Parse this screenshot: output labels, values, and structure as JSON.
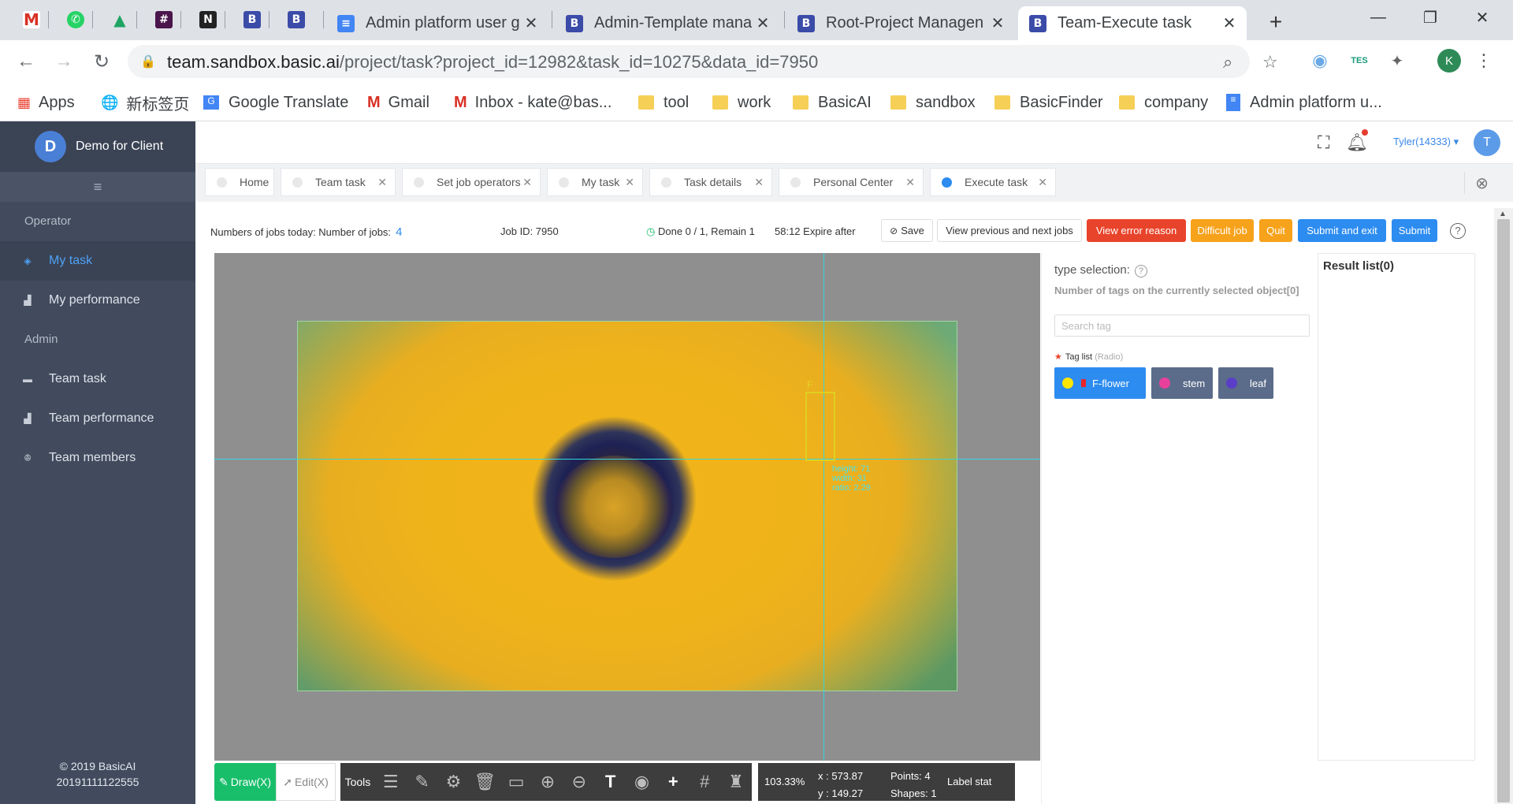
{
  "browser": {
    "pinned_tabs": [
      {
        "icon": "gmail-icon",
        "glyph": "M",
        "color": "#d93025"
      },
      {
        "icon": "whatsapp-icon",
        "glyph": "✆",
        "color": "#25d366"
      },
      {
        "icon": "google-drive-icon",
        "glyph": "▲",
        "color": "#1fa463"
      },
      {
        "icon": "slack-icon",
        "glyph": "#",
        "color": "#4a154b"
      },
      {
        "icon": "notion-icon",
        "glyph": "N",
        "color": "#222222"
      },
      {
        "icon": "basicai-icon",
        "glyph": "B",
        "color": "#3b4ba8"
      },
      {
        "icon": "basicai-icon",
        "glyph": "B",
        "color": "#3b4ba8"
      }
    ],
    "tabs": [
      {
        "title": "Admin platform user g",
        "icon": "google-docs-icon",
        "active": false
      },
      {
        "title": "Admin-Template mana",
        "icon": "basicai-icon",
        "active": false
      },
      {
        "title": "Root-Project Managen",
        "icon": "basicai-icon",
        "active": false
      },
      {
        "title": "Team-Execute task",
        "icon": "basicai-icon",
        "active": true
      }
    ],
    "new_tab": "+",
    "window_controls": {
      "minimize": "—",
      "restore": "❐",
      "close": "✕"
    },
    "url_host": "team.sandbox.basic.ai",
    "url_path": "/project/task?project_id=12982&task_id=10275&data_id=7950",
    "bookmarks": [
      {
        "label": "Apps",
        "icon": "apps-grid-icon"
      },
      {
        "label": "新标签页",
        "icon": "globe-icon"
      },
      {
        "label": "Google Translate",
        "icon": "google-translate-icon"
      },
      {
        "label": "Gmail",
        "icon": "gmail-icon"
      },
      {
        "label": "Inbox - kate@bas...",
        "icon": "gmail-icon"
      },
      {
        "label": "tool",
        "icon": "folder-icon"
      },
      {
        "label": "work",
        "icon": "folder-icon"
      },
      {
        "label": "BasicAI",
        "icon": "folder-icon"
      },
      {
        "label": "sandbox",
        "icon": "folder-icon"
      },
      {
        "label": "BasicFinder",
        "icon": "folder-icon"
      },
      {
        "label": "company",
        "icon": "folder-icon"
      },
      {
        "label": "Admin platform u...",
        "icon": "google-docs-icon"
      }
    ],
    "extension_label": "TES",
    "profile_initial": "K"
  },
  "sidebar": {
    "brand_initial": "D",
    "brand_name": "Demo for Client",
    "groups": [
      {
        "label": "Operator",
        "items": [
          {
            "label": "My task",
            "icon": "layers-icon",
            "active": true
          },
          {
            "label": "My performance",
            "icon": "bar-chart-icon",
            "active": false
          }
        ]
      },
      {
        "label": "Admin",
        "items": [
          {
            "label": "Team task",
            "icon": "briefcase-icon",
            "active": false
          },
          {
            "label": "Team performance",
            "icon": "bar-chart-icon",
            "active": false
          },
          {
            "label": "Team members",
            "icon": "people-icon",
            "active": false
          }
        ]
      }
    ],
    "footer_copyright": "© 2019 BasicAI",
    "footer_build": "20191111122555"
  },
  "topbar": {
    "user": "Tyler(14333)",
    "avatar_initial": "T"
  },
  "page_tabs": [
    {
      "label": "Home",
      "closable": false,
      "active": false
    },
    {
      "label": "Team task",
      "closable": true,
      "active": false
    },
    {
      "label": "Set job operators",
      "closable": true,
      "active": false
    },
    {
      "label": "My task",
      "closable": true,
      "active": false
    },
    {
      "label": "Task details",
      "closable": true,
      "active": false
    },
    {
      "label": "Personal Center",
      "closable": true,
      "active": false
    },
    {
      "label": "Execute task",
      "closable": true,
      "active": true
    }
  ],
  "actionbar": {
    "jobs_today_label": "Numbers of jobs today: Number of jobs:",
    "jobs_today_value": "4",
    "job_id": "Job ID: 7950",
    "progress": "Done 0 / 1, Remain 1",
    "expire": "58:12 Expire after",
    "save": "Save",
    "view_prev_next": "View previous and next jobs",
    "view_error": "View error reason",
    "difficult": "Difficult job",
    "quit": "Quit",
    "submit_exit": "Submit and exit",
    "submit": "Submit",
    "help": "?"
  },
  "canvas": {
    "annotation_label": "F",
    "measure": {
      "height": "height: 71",
      "width": "width: 31",
      "ratio": "ratio: 2.29"
    },
    "annotation_color": "#e0d020",
    "crosshair_color": "#35d4e0"
  },
  "toolbar": {
    "draw": "Draw(X)",
    "edit": "Edit(X)",
    "tools_label": "Tools",
    "tool_icons": [
      "sliders-icon",
      "pencil-icon",
      "gear-icon",
      "trash-icon",
      "monitor-icon",
      "zoom-in-icon",
      "zoom-out-icon",
      "text-icon",
      "eye-icon",
      "crosshair-icon",
      "grid-icon",
      "brush-icon"
    ],
    "zoom": "103.33%",
    "x": "x : 573.87",
    "y": "y : 149.27",
    "points": "Points:  4",
    "shapes": "Shapes:  1",
    "label_stat": "Label stat"
  },
  "type_panel": {
    "title": "type selection:",
    "selected_count": "Number of tags on the currently selected object[0]",
    "search_placeholder": "Search tag",
    "tag_list_label": "Tag list",
    "tag_list_mode": "(Radio)",
    "tags": [
      {
        "label": "F-flower",
        "dot_color": "#ffe600",
        "bg": "#2d8cf0",
        "marker": true
      },
      {
        "label": "stem",
        "dot_color": "#e8409a",
        "bg": "#5b6c8a",
        "marker": false
      },
      {
        "label": "leaf",
        "dot_color": "#5a3ec8",
        "bg": "#5b6c8a",
        "marker": false
      }
    ]
  },
  "result_panel": {
    "title": "Result list(0)"
  }
}
